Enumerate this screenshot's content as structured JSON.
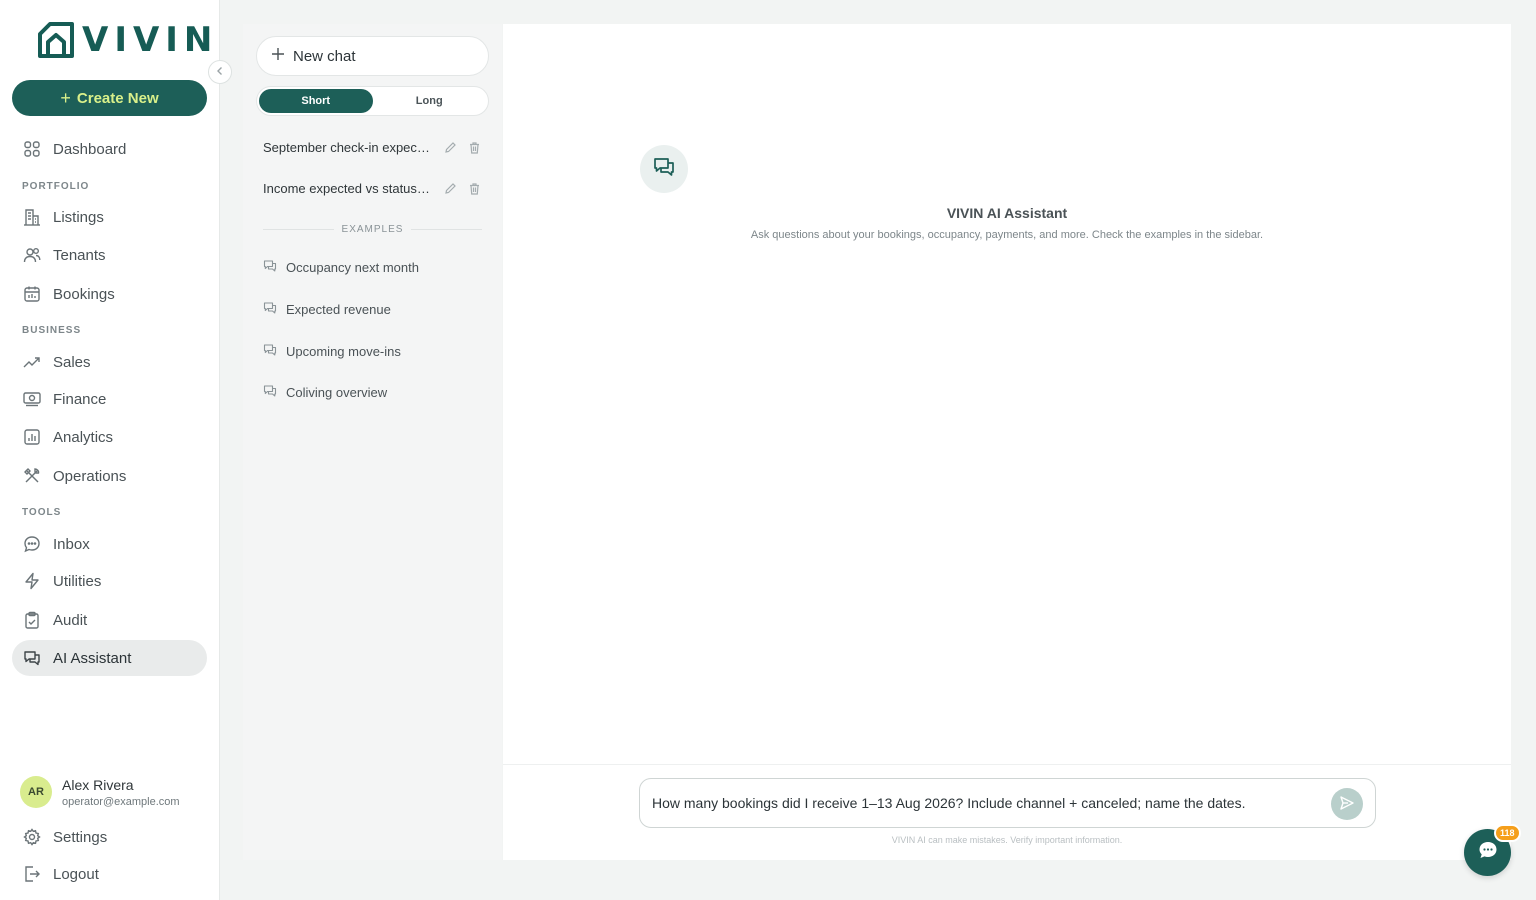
{
  "brand": {
    "name": "VIVIN",
    "color": "#1d5f58",
    "accent": "#d9f08a"
  },
  "sidebar": {
    "create_label": "Create New",
    "dashboard": {
      "label": "Dashboard",
      "icon": "grid-icon"
    },
    "sections": {
      "portfolio": "PORTFOLIO",
      "business": "BUSINESS",
      "tools": "TOOLS"
    },
    "items": {
      "listings": {
        "label": "Listings",
        "icon": "building-icon"
      },
      "tenants": {
        "label": "Tenants",
        "icon": "users-icon"
      },
      "bookings": {
        "label": "Bookings",
        "icon": "calendar-icon"
      },
      "sales": {
        "label": "Sales",
        "icon": "trend-up-icon"
      },
      "finance": {
        "label": "Finance",
        "icon": "money-icon"
      },
      "analytics": {
        "label": "Analytics",
        "icon": "chart-icon"
      },
      "operations": {
        "label": "Operations",
        "icon": "tools-icon"
      },
      "inbox": {
        "label": "Inbox",
        "icon": "chat-bubble-icon"
      },
      "utilities": {
        "label": "Utilities",
        "icon": "lightning-icon"
      },
      "audit": {
        "label": "Audit",
        "icon": "clipboard-icon"
      },
      "ai_assistant": {
        "label": "AI Assistant",
        "icon": "chat-bubbles-icon"
      }
    },
    "user": {
      "initials": "AR",
      "name": "Alex Rivera",
      "email": "operator@example.com"
    },
    "settings_label": "Settings",
    "logout_label": "Logout"
  },
  "chats": {
    "new_chat_label": "New chat",
    "toggle": {
      "short": "Short",
      "long": "Long",
      "selected": "Short"
    },
    "history": [
      {
        "title": "September check-in expectations"
      },
      {
        "title": "Income expected vs status breakdown"
      }
    ],
    "examples_label": "EXAMPLES",
    "examples": [
      {
        "label": "Occupancy next month"
      },
      {
        "label": "Expected revenue"
      },
      {
        "label": "Upcoming move-ins"
      },
      {
        "label": "Coliving overview"
      }
    ]
  },
  "main": {
    "title": "VIVIN AI Assistant",
    "subtitle": "Ask questions about your bookings, occupancy, payments, and more. Check the examples in the sidebar.",
    "input_value": "How many bookings did I receive 1–13 Aug 2026? Include channel + canceled; name the dates.",
    "disclaimer": "VIVIN AI can make mistakes. Verify important information."
  },
  "fab": {
    "badge": "118"
  }
}
